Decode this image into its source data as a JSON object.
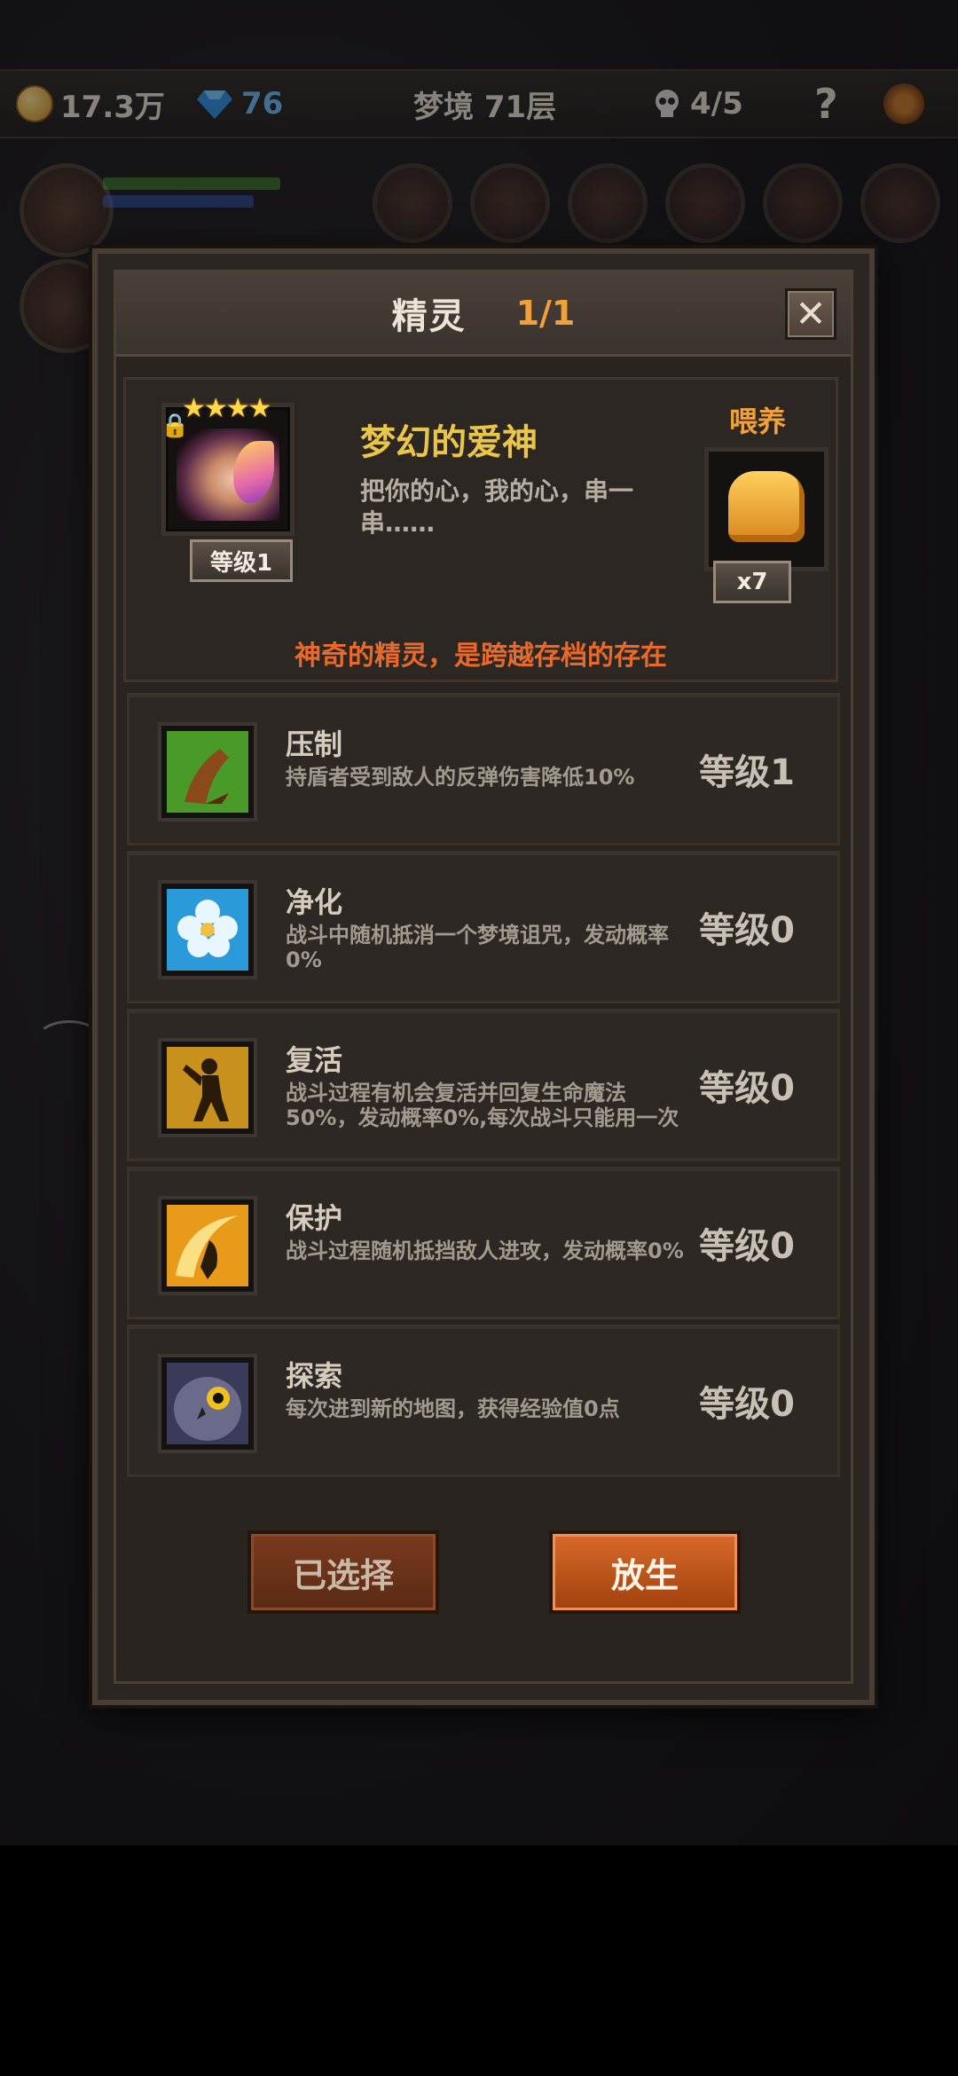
{
  "topbar": {
    "gold": "17.3万",
    "gems": "76",
    "dungeon": "梦境 71层",
    "skulls": "4/5",
    "help": "?"
  },
  "modal": {
    "title": "精灵",
    "count": "1/1",
    "close": "✕"
  },
  "sprite": {
    "stars": "★★★★",
    "level": "等级1",
    "name": "梦幻的爱神",
    "description": "把你的心，我的心，串一串……",
    "feed_label": "喂养",
    "feed_count": "x7",
    "note": "神奇的精灵，是跨越存档的存在"
  },
  "skills": [
    {
      "name": "压制",
      "desc": "持盾者受到敌人的反弹伤害降低10%",
      "level": "等级1"
    },
    {
      "name": "净化",
      "desc": "战斗中随机抵消一个梦境诅咒，发动概率0%",
      "level": "等级0"
    },
    {
      "name": "复活",
      "desc": "战斗过程有机会复活并回复生命魔法50%，发动概率0%,每次战斗只能用一次",
      "level": "等级0"
    },
    {
      "name": "保护",
      "desc": "战斗过程随机抵挡敌人进攻，发动概率0%",
      "level": "等级0"
    },
    {
      "name": "探索",
      "desc": "每次进到新的地图，获得经验值0点",
      "level": "等级0"
    }
  ],
  "buttons": {
    "selected": "已选择",
    "release": "放生"
  },
  "colors": {
    "accent_orange": "#f2a038",
    "name_gold": "#e9c64a",
    "note_red": "#e86a2a"
  }
}
